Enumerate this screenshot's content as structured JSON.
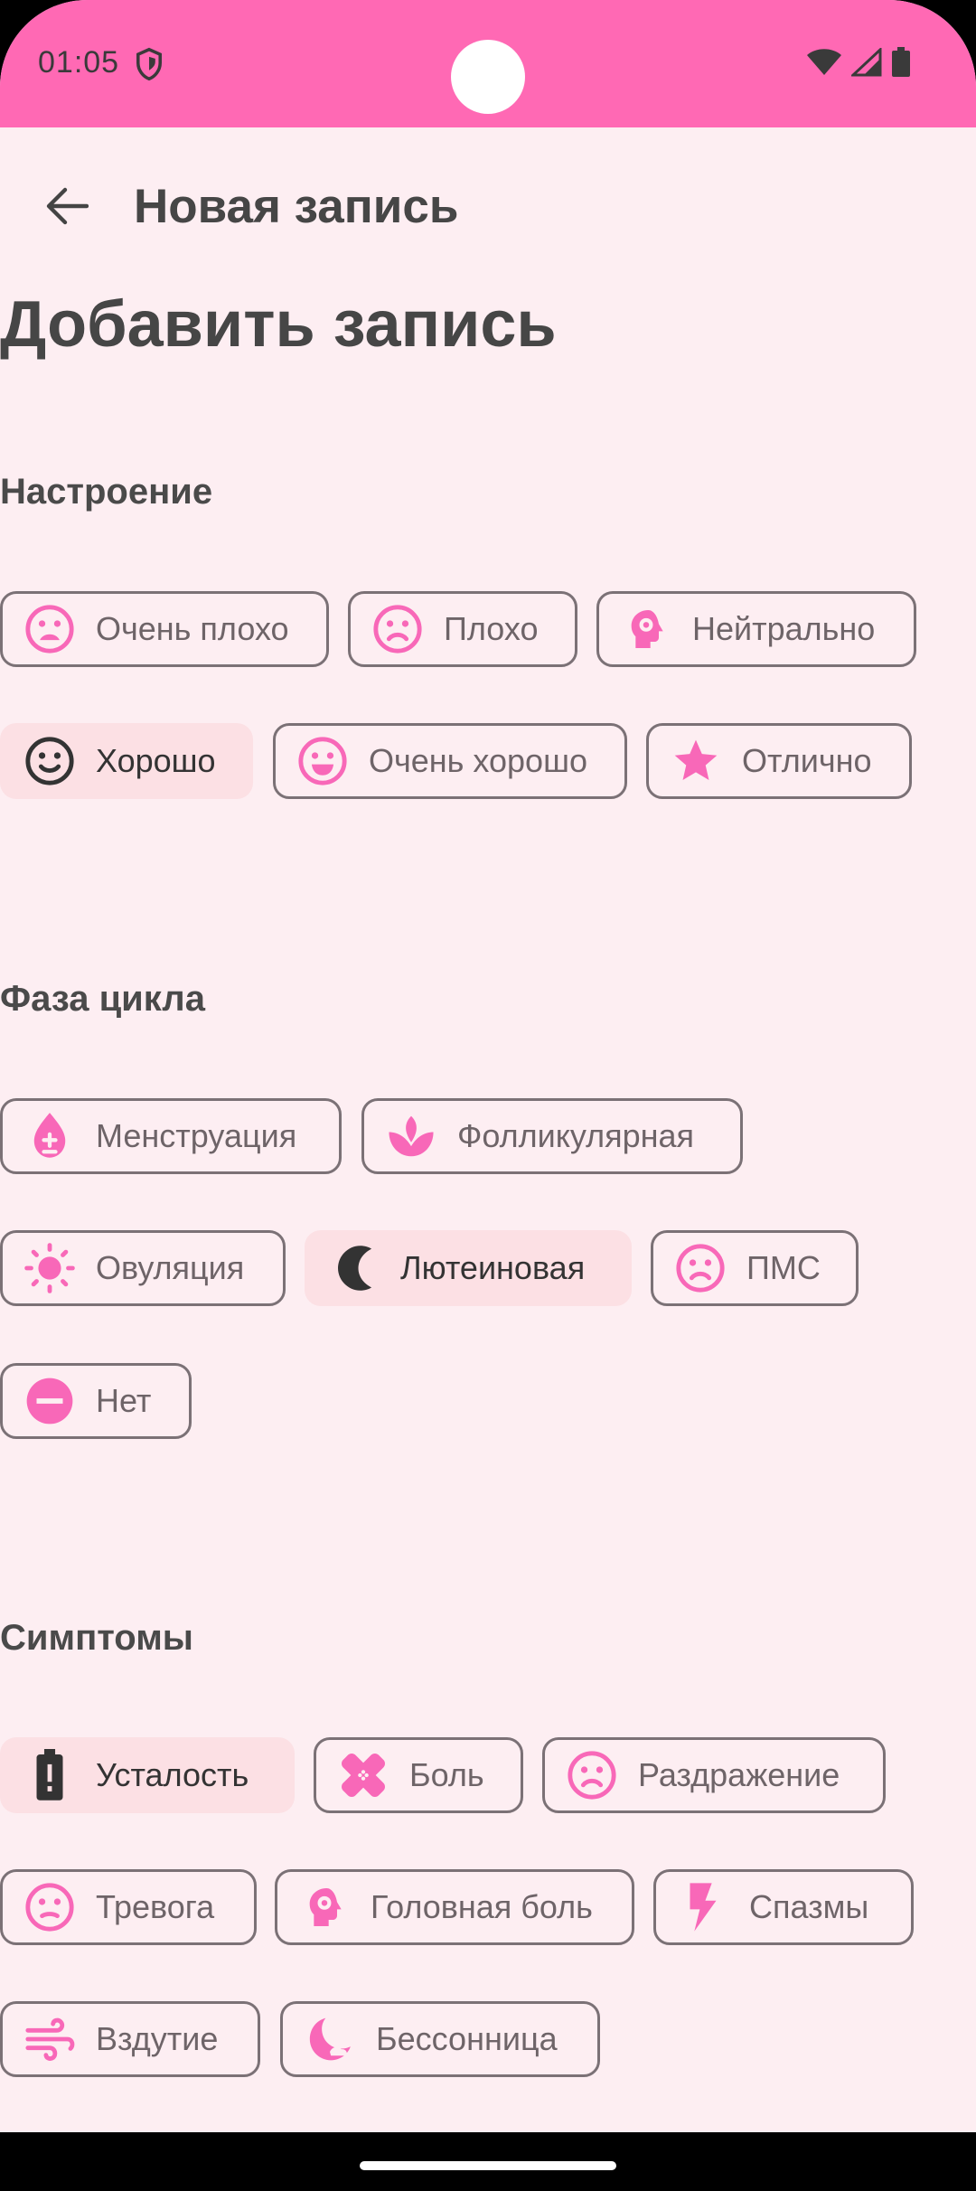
{
  "status_bar": {
    "time": "01:05"
  },
  "app_bar": {
    "title": "Новая запись"
  },
  "page": {
    "title": "Добавить запись"
  },
  "mood": {
    "label": "Настроение",
    "chips": [
      {
        "label": "Очень плохо",
        "icon": "very-sad-face-icon",
        "selected": false
      },
      {
        "label": "Плохо",
        "icon": "sad-face-icon",
        "selected": false
      },
      {
        "label": "Нейтрально",
        "icon": "head-gear-icon",
        "selected": false
      },
      {
        "label": "Хорошо",
        "icon": "smile-face-icon",
        "selected": true
      },
      {
        "label": "Очень хорошо",
        "icon": "happy-face-icon",
        "selected": false
      },
      {
        "label": "Отлично",
        "icon": "star-icon",
        "selected": false
      }
    ]
  },
  "phase": {
    "label": "Фаза цикла",
    "chips": [
      {
        "label": "Менструация",
        "icon": "drop-icon",
        "selected": false
      },
      {
        "label": "Фолликулярная",
        "icon": "lotus-icon",
        "selected": false
      },
      {
        "label": "Овуляция",
        "icon": "sun-icon",
        "selected": false
      },
      {
        "label": "Лютеиновая",
        "icon": "moon-icon",
        "selected": true
      },
      {
        "label": "ПМС",
        "icon": "sad-face-icon",
        "selected": false
      },
      {
        "label": "Нет",
        "icon": "minus-circle-icon",
        "selected": false
      }
    ]
  },
  "symptoms": {
    "label": "Симптомы",
    "chips": [
      {
        "label": "Усталость",
        "icon": "battery-alert-icon",
        "selected": true
      },
      {
        "label": "Боль",
        "icon": "bandage-icon",
        "selected": false
      },
      {
        "label": "Раздражение",
        "icon": "sad-face-icon",
        "selected": false
      },
      {
        "label": "Тревога",
        "icon": "neutral-face-icon",
        "selected": false
      },
      {
        "label": "Головная боль",
        "icon": "head-gear-icon",
        "selected": false
      },
      {
        "label": "Спазмы",
        "icon": "lightning-icon",
        "selected": false
      },
      {
        "label": "Вздутие",
        "icon": "wind-icon",
        "selected": false
      },
      {
        "label": "Бессонница",
        "icon": "bedtime-icon",
        "selected": false
      }
    ]
  },
  "colors": {
    "accent": "#FF69B4",
    "background": "#FDEEF2",
    "selected_chip": "#FCE0E4",
    "text": "#464646"
  }
}
